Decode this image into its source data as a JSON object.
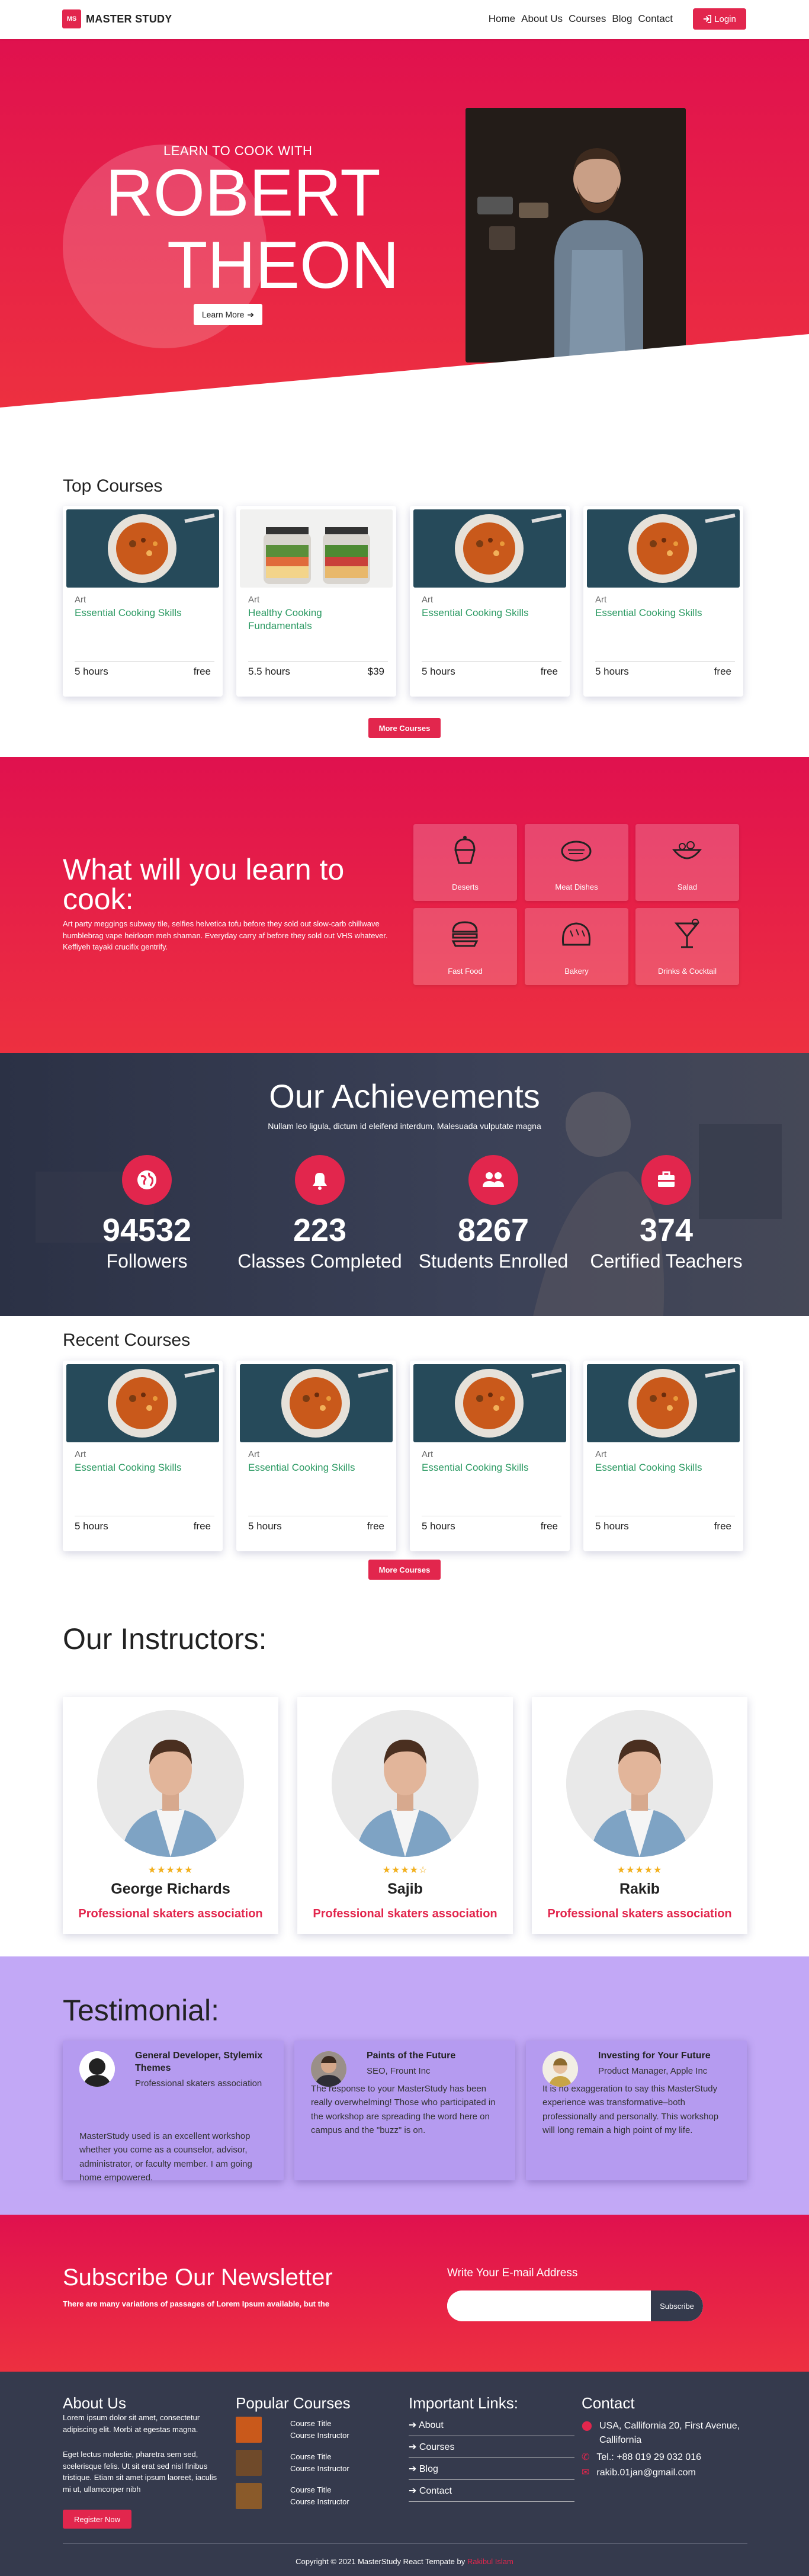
{
  "nav": {
    "logo_mark": "MS",
    "logo_text": "MASTER STUDY",
    "links": [
      "Home",
      "About Us",
      "Courses",
      "Blog",
      "Contact"
    ],
    "login_label": "Login"
  },
  "hero": {
    "subtitle": "LEARN TO COOK WITH",
    "name_line1": "ROBERT",
    "name_line2": "THEON",
    "button_label": "Learn More"
  },
  "top_courses": {
    "title": "Top Courses",
    "items": [
      {
        "category": "Art",
        "title": "Essential Cooking Skills",
        "hours": "5 hours",
        "price": "free",
        "image": "soup-bowl"
      },
      {
        "category": "Art",
        "title": "Healthy Cooking Fundamentals",
        "hours": "5.5 hours",
        "price": "$39",
        "image": "salad-jars"
      },
      {
        "category": "Art",
        "title": "Essential Cooking Skills",
        "hours": "5 hours",
        "price": "free",
        "image": "soup-bowl"
      },
      {
        "category": "Art",
        "title": "Essential Cooking Skills",
        "hours": "5 hours",
        "price": "free",
        "image": "soup-bowl"
      }
    ],
    "more_label": "More Courses"
  },
  "learn": {
    "title": "What will you learn to cook:",
    "text": "Art party meggings subway tile, selfies helvetica tofu before they sold out slow-carb chillwave humblebrag vape heirloom meh shaman. Everyday carry af before they sold out VHS whatever. Keffiyeh tayaki crucifix gentrify.",
    "tiles": [
      {
        "label": "Deserts",
        "icon": "cupcake-icon"
      },
      {
        "label": "Meat Dishes",
        "icon": "steak-icon"
      },
      {
        "label": "Salad",
        "icon": "salad-icon"
      },
      {
        "label": "Fast Food",
        "icon": "burger-icon"
      },
      {
        "label": "Bakery",
        "icon": "bread-icon"
      },
      {
        "label": "Drinks & Cocktail",
        "icon": "cocktail-icon"
      }
    ]
  },
  "achievements": {
    "title": "Our Achievements",
    "subtitle": "Nullam leo ligula, dictum id eleifend interdum, Malesuada vulputate magna",
    "stats": [
      {
        "number": "94532",
        "label": "Followers",
        "icon": "globe-icon"
      },
      {
        "number": "223",
        "label": "Classes Completed",
        "icon": "bell-icon"
      },
      {
        "number": "8267",
        "label": "Students Enrolled",
        "icon": "users-icon"
      },
      {
        "number": "374",
        "label": "Certified Teachers",
        "icon": "briefcase-icon"
      }
    ]
  },
  "recent_courses": {
    "title": "Recent Courses",
    "items": [
      {
        "category": "Art",
        "title": "Essential Cooking Skills",
        "hours": "5 hours",
        "price": "free"
      },
      {
        "category": "Art",
        "title": "Essential Cooking Skills",
        "hours": "5 hours",
        "price": "free"
      },
      {
        "category": "Art",
        "title": "Essential Cooking Skills",
        "hours": "5 hours",
        "price": "free"
      },
      {
        "category": "Art",
        "title": "Essential Cooking Skills",
        "hours": "5 hours",
        "price": "free"
      }
    ],
    "more_label": "More Courses"
  },
  "instructors": {
    "title": "Our Instructors:",
    "items": [
      {
        "name": "George Richards",
        "role": "Professional skaters association",
        "stars": "★★★★★"
      },
      {
        "name": "Sajib",
        "role": "Professional skaters association",
        "stars": "★★★★☆"
      },
      {
        "name": "Rakib",
        "role": "Professional skaters association",
        "stars": "★★★★★"
      }
    ]
  },
  "testimonials": {
    "title": "Testimonial:",
    "items": [
      {
        "name": "General Developer, Stylemix Themes",
        "role": "Professional skaters association",
        "text": "MasterStudy used is an excellent workshop whether you come as a counselor, advisor, administrator, or faculty member. I am going home empowered."
      },
      {
        "name": "Paints of the Future",
        "role": "SEO, Frount Inc",
        "text": "The response to your MasterStudy has been really overwhelming! Those who participated in the workshop are spreading the word here on campus and the \"buzz\" is on."
      },
      {
        "name": "Investing for Your Future",
        "role": "Product Manager, Apple Inc",
        "text": "It is no exaggeration to say this MasterStudy experience was transformative–both professionally and personally. This workshop will long remain a high point of my life."
      }
    ]
  },
  "newsletter": {
    "title": "Subscribe Our Newsletter",
    "text": "There are many variations of passages of Lorem Ipsum available, but the",
    "input_label": "Write Your E-mail Address",
    "input_placeholder": "",
    "button_label": "Subscribe"
  },
  "footer": {
    "about_title": "About Us",
    "about_text1": "Lorem ipsum dolor sit amet, consectetur adipiscing elit. Morbi at egestas magna.",
    "about_text2": "Eget lectus molestie, pharetra sem sed, scelerisque felis. Ut sit erat sed nisl finibus tristique. Etiam sit amet ipsum laoreet, iaculis mi ut, ullamcorper nibh",
    "register_label": "Register Now",
    "popular_title": "Popular Courses",
    "popular_items": [
      {
        "line1": "Course Title",
        "line2": "Course Instructor"
      },
      {
        "line1": "Course Title",
        "line2": "Course Instructor"
      },
      {
        "line1": "Course Title",
        "line2": "Course Instructor"
      }
    ],
    "links_title": "Important Links:",
    "links": [
      "About",
      "Courses",
      "Blog",
      "Contact"
    ],
    "contact_title": "Contact",
    "address": "USA, Callifornia 20, First Avenue, Callifornia",
    "phone": "Tel.: +88 019 29 032 016",
    "email": "rakib.01jan@gmail.com",
    "copyright": "Copyright © 2021 MasterStudy React Tempate by",
    "author": "Rakibul Islam"
  },
  "colors": {
    "accent": "#e2264d",
    "course_title": "#2c9a63",
    "footer_bg": "#353a4d",
    "testimonial_bg": "#c2a8f6"
  }
}
